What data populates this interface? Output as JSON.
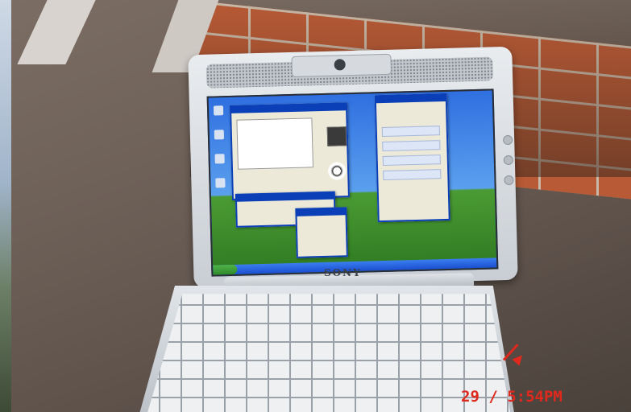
{
  "photo": {
    "subject": "laptop",
    "brand_label": "SONY",
    "timestamp_stamp": "29 / 5:54PM"
  },
  "colors": {
    "wall": "#b85a35",
    "screen_desktop": "#2f6fe0",
    "stamp": "#e0281c"
  }
}
